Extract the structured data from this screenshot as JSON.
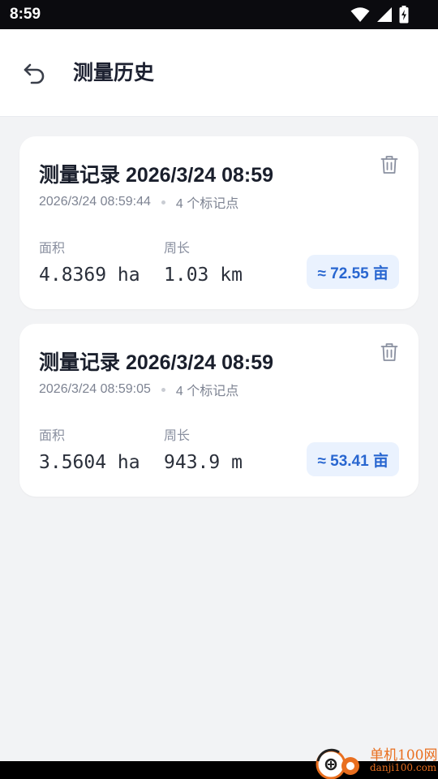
{
  "status_bar": {
    "time": "8:59"
  },
  "header": {
    "title": "测量历史",
    "back_icon": "undo-arrow-icon"
  },
  "records": [
    {
      "title": "测量记录 2026/3/24 08:59",
      "timestamp": "2026/3/24 08:59:44",
      "points": "4 个标记点",
      "area_label": "面积",
      "area_value": "4.8369 ha",
      "perimeter_label": "周长",
      "perimeter_value": "1.03 km",
      "mu": "≈ 72.55 亩"
    },
    {
      "title": "测量记录 2026/3/24 08:59",
      "timestamp": "2026/3/24 08:59:05",
      "points": "4 个标记点",
      "area_label": "面积",
      "area_value": "3.5604 ha",
      "perimeter_label": "周长",
      "perimeter_value": "943.9 m",
      "mu": "≈ 53.41 亩"
    }
  ],
  "watermark": {
    "name": "单机100网",
    "url": "danji100.com"
  },
  "colors": {
    "accent": "#2866d0",
    "badge_bg": "#eaf2fe",
    "background": "#f2f3f5",
    "watermark": "#e96f1f"
  }
}
